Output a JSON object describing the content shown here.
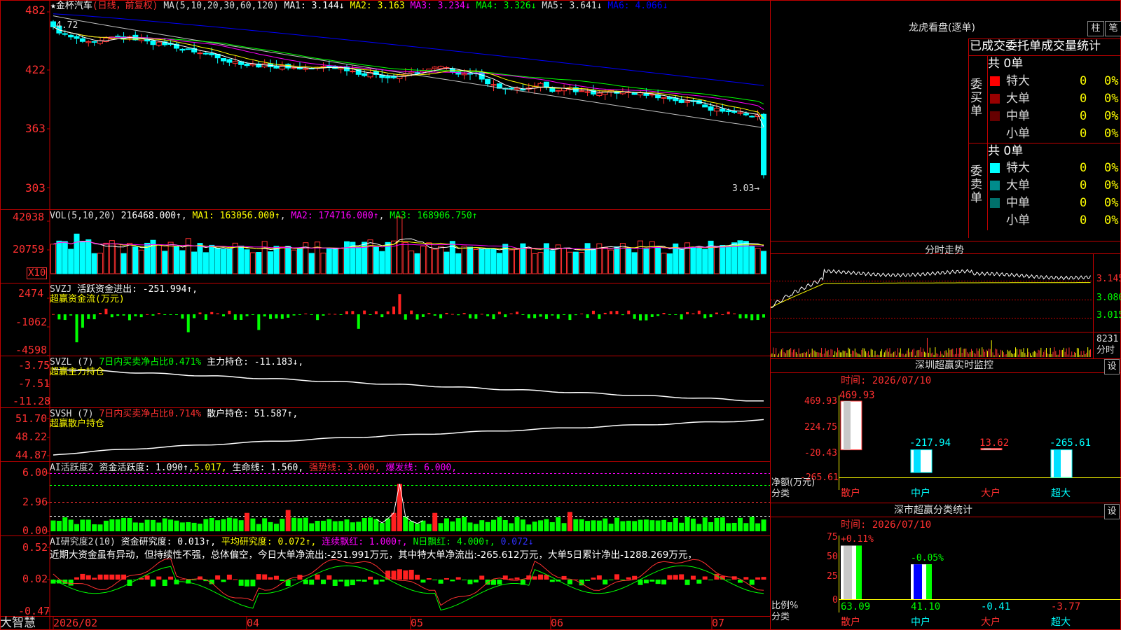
{
  "colors": {
    "up": "#ff3030",
    "down": "#00ffff",
    "frame": "#c00000",
    "ma1": "#ffffff",
    "ma2": "#ffff00",
    "ma3": "#ff00ff",
    "ma4": "#00ff00",
    "ma5": "#c0c0c0",
    "ma6": "#0000ff",
    "pos": "#ff2020",
    "neg": "#00ff00"
  },
  "kline": {
    "title_prefix": "★金杯汽车",
    "mode": "(日线，前复权)",
    "ma_spec": "MA(5,10,20,30,60,120)",
    "ma_values": [
      {
        "label": "MA1: 3.144↓",
        "color": "#ffffff"
      },
      {
        "label": "MA2: 3.163",
        "color": "#ffff00"
      },
      {
        "label": "MA3: 3.234↓",
        "color": "#ff00ff"
      },
      {
        "label": "MA4: 3.326↓",
        "color": "#00ff00"
      },
      {
        "label": "MA5: 3.641↓",
        "color": "#c0c0c0"
      },
      {
        "label": "MA6: 4.066↓",
        "color": "#0000ff"
      }
    ],
    "y_ticks": [
      "482",
      "422",
      "363",
      "303"
    ],
    "ylim": [
      2.9,
      4.85
    ],
    "high_label": "4.72",
    "low_label": "3.03→"
  },
  "vol": {
    "header": "VOL(5,10,20)",
    "value": "216468.000↑",
    "ma1": "MA1: 163056.000↑",
    "ma2": "MA2: 174716.000↑",
    "ma3": "MA3: 168906.750↑",
    "y_ticks": [
      "42038",
      "20759"
    ],
    "unit": "X10"
  },
  "svzj": {
    "header": "SVZJ",
    "value": "活跃资金进出: -251.994↑,",
    "subtitle": "超赢资金流(万元)",
    "y_ticks": [
      "2474",
      "-1062",
      "-4598"
    ]
  },
  "svzl": {
    "header": "SVZL (7)",
    "ratio": "7日内买卖净占比0.471%",
    "value": "主力持仓: -11.183↓,",
    "subtitle": "超赢主力持仓",
    "y_ticks": [
      "-3.75",
      "-7.51",
      "-11.28"
    ]
  },
  "svsh": {
    "header": "SVSH (7)",
    "ratio": "7日内买卖净占比0.714%",
    "value": "散户持仓: 51.587↑,",
    "subtitle": "超赢散户持仓",
    "y_ticks": [
      "51.70",
      "48.22",
      "44.87"
    ]
  },
  "ai_active": {
    "header": "AI活跃度2",
    "v1": "资金活跃度: 1.090↑,",
    "v2": "5.017,",
    "v3": "生命线: 1.560,",
    "v4": "强势线: 3.000,",
    "v5": "爆发线: 6.000,",
    "y_ticks": [
      "6.00",
      "2.96",
      "0.00"
    ]
  },
  "ai_research": {
    "header": "AI研究度2(10)",
    "v1": "资金研究度: 0.013↑,",
    "v2": "平均研究度: 0.072↑,",
    "v3": "连续飘红: 1.000↑,",
    "v4": "N日飘红: 4.000↑,",
    "v5": "0.072↓",
    "comment": "近期大资金虽有异动，但持续性不强，总体偏空，今日大单净流出:-251.991万元，其中特大单净流出:-265.612万元，大单5日累计净出-1288.269万元，",
    "y_ticks": [
      "0.52",
      "0.02",
      "-0.47"
    ]
  },
  "x_axis": {
    "labels": [
      "2026/02",
      "04",
      "05",
      "06",
      "07"
    ],
    "brand": "大智慧"
  },
  "dragon": {
    "title": "龙虎看盘(逐单)",
    "tab1": "柱",
    "tab2": "笔",
    "subtitle": "已成交委托单成交量统计",
    "buy_group": "委买单",
    "sell_group": "委卖单",
    "buy_total": "共 0单",
    "sell_total": "共 0单",
    "buy_rows": [
      {
        "label": "特大",
        "count": "0",
        "pct": "0%",
        "color": "#ff0000"
      },
      {
        "label": "大单",
        "count": "0",
        "pct": "0%",
        "color": "#990000"
      },
      {
        "label": "中单",
        "count": "0",
        "pct": "0%",
        "color": "#660000"
      },
      {
        "label": "小单",
        "count": "0",
        "pct": "0%",
        "color": "#000000"
      }
    ],
    "sell_rows": [
      {
        "label": "特大",
        "count": "0",
        "pct": "0%",
        "color": "#00ffff"
      },
      {
        "label": "大单",
        "count": "0",
        "pct": "0%",
        "color": "#008b8b"
      },
      {
        "label": "中单",
        "count": "0",
        "pct": "0%",
        "color": "#00706b"
      },
      {
        "label": "小单",
        "count": "0",
        "pct": "0%",
        "color": "#000000"
      }
    ]
  },
  "intraday": {
    "title": "分时走势",
    "y_ticks": [
      "3.145",
      "3.080",
      "3.015"
    ],
    "vol_tick": "8231",
    "vol_label": "分时"
  },
  "sz_monitor": {
    "title": "深圳超赢实时监控",
    "settings": "设",
    "time": "时间: 2026/07/10",
    "y_ticks": [
      "469.93",
      "224.75",
      "-20.43",
      "-265.61"
    ],
    "ylabel": "净额(万元)",
    "xlabel": "分类",
    "chart_data": {
      "type": "bar",
      "categories": [
        "散户",
        "中户",
        "大户",
        "超大"
      ],
      "values": [
        469.93,
        -217.94,
        13.62,
        -265.61
      ],
      "labels": [
        "469.93",
        "-217.94",
        "13.62",
        "-265.61"
      ],
      "ylim": [
        -265.61,
        469.93
      ]
    }
  },
  "sz_class": {
    "title": "深市超赢分类统计",
    "settings": "设",
    "time": "时间: 2026/07/10",
    "y_ticks": [
      "75",
      "50",
      "25",
      "0"
    ],
    "ylabel": "比例%",
    "xlabel": "分类",
    "chart_data": {
      "type": "bar",
      "categories": [
        "散户",
        "中户",
        "大户",
        "超大"
      ],
      "values": [
        63.09,
        41.1,
        -0.41,
        -3.77
      ],
      "change_labels": [
        "+0.11%",
        "-0.05%",
        "",
        ""
      ],
      "value_labels": [
        "63.09",
        "41.10",
        "-0.41",
        "-3.77"
      ],
      "ylim": [
        0,
        75
      ]
    }
  }
}
